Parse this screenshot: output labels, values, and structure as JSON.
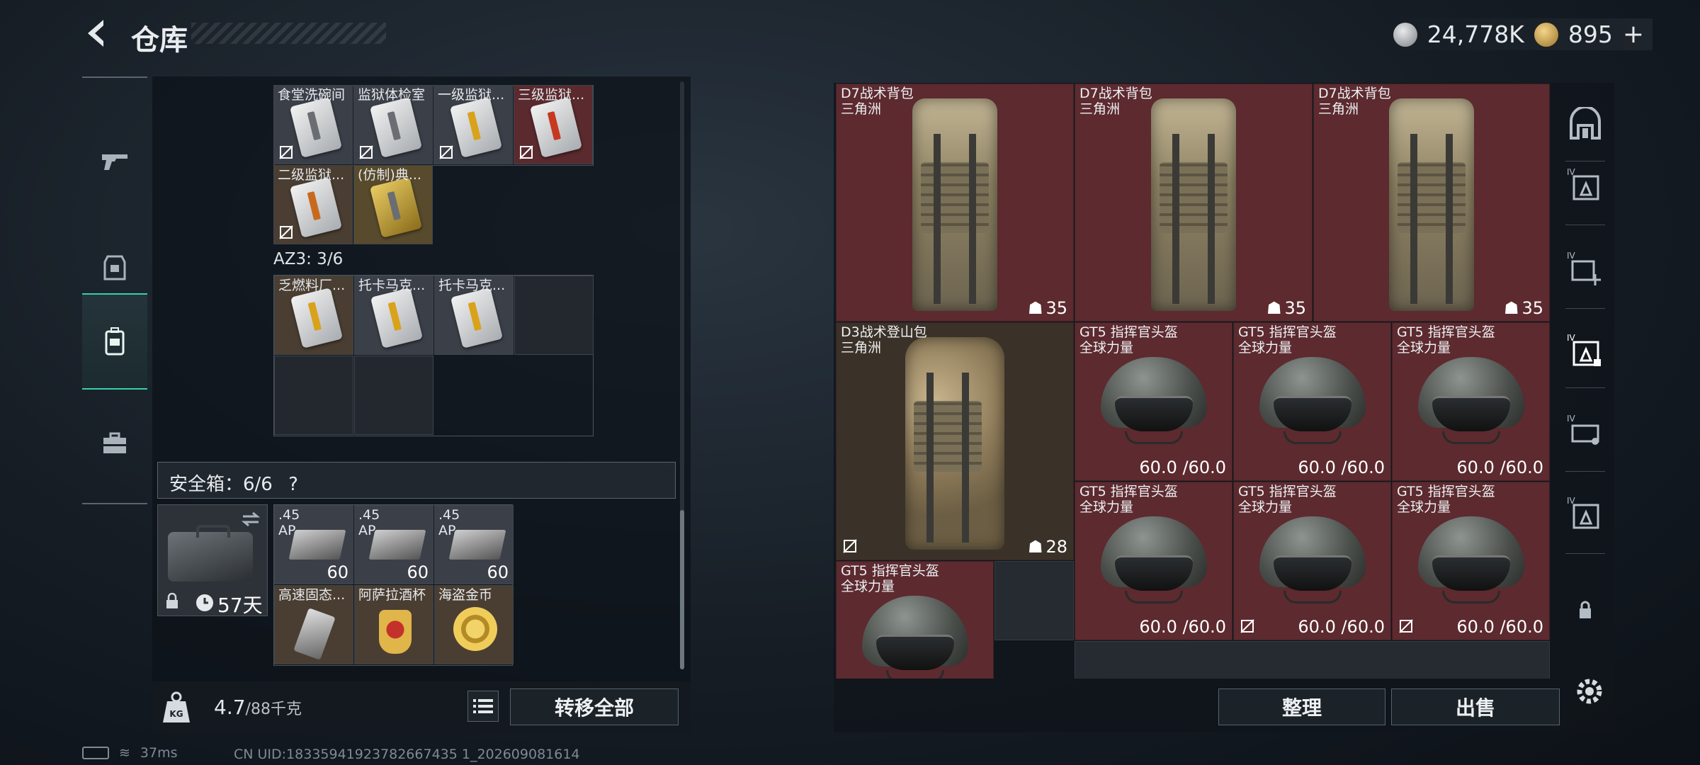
{
  "header": {
    "title": "仓库",
    "currency_primary": "24,778K",
    "currency_secondary": "895",
    "add_label": "+"
  },
  "upper_items": [
    {
      "label": "食堂洗碗间",
      "bg": "grey",
      "key": "grey",
      "not_tradable": true
    },
    {
      "label": "监狱体检室",
      "bg": "grey",
      "key": "grey",
      "not_tradable": false
    },
    {
      "label": "一级监狱...",
      "bg": "grey",
      "key": "yellow",
      "not_tradable": true
    },
    {
      "label": "三级监狱...",
      "bg": "red",
      "key": "red",
      "not_tradable": true
    },
    {
      "label": "二级监狱...",
      "bg": "brown",
      "key": "orange",
      "not_tradable": true
    },
    {
      "label": "(仿制)典...",
      "bg": "gold",
      "key": "gold",
      "not_tradable": false
    }
  ],
  "az3": {
    "label": "AZ3: 3/6",
    "items": [
      {
        "label": "乏燃料厂...",
        "bg": "brown"
      },
      {
        "label": "托卡马克...",
        "bg": "grey"
      },
      {
        "label": "托卡马克...",
        "bg": "grey"
      }
    ]
  },
  "safe_box": {
    "label": "安全箱：6/6",
    "help": "?",
    "days": "57天",
    "items": [
      {
        "label": ".45",
        "label2": "AP",
        "count": "60"
      },
      {
        "label": ".45",
        "label2": "AP",
        "count": "60"
      },
      {
        "label": ".45",
        "label2": "AP",
        "count": "60"
      },
      {
        "label": "高速固态..."
      },
      {
        "label": "阿萨拉酒杯"
      },
      {
        "label": "海盗金币"
      }
    ]
  },
  "weight": {
    "current": "4.7",
    "max": "/88千克"
  },
  "buttons": {
    "transfer_all": "转移全部",
    "sort": "整理",
    "sell": "出售"
  },
  "stash_items": [
    {
      "name": "D7战术背包",
      "origin": "三角洲",
      "value": "35",
      "type": "backpack"
    },
    {
      "name": "D7战术背包",
      "origin": "三角洲",
      "value": "35",
      "type": "backpack"
    },
    {
      "name": "D7战术背包",
      "origin": "三角洲",
      "value": "35",
      "type": "backpack"
    },
    {
      "name": "D3战术登山包",
      "origin": "三角洲",
      "value": "28",
      "type": "backpack"
    },
    {
      "name": "GT5 指挥官头盔",
      "origin": "全球力量",
      "value": "60.0 /60.0",
      "type": "helmet"
    },
    {
      "name": "GT5 指挥官头盔",
      "origin": "全球力量",
      "value": "60.0 /60.0",
      "type": "helmet"
    },
    {
      "name": "GT5 指挥官头盔",
      "origin": "全球力量",
      "value": "60.0 /60.0",
      "type": "helmet"
    },
    {
      "name": "GT5 指挥官头盔",
      "origin": "全球力量",
      "value": "60.0 /60.0",
      "type": "helmet"
    },
    {
      "name": "GT5 指挥官头盔",
      "origin": "全球力量",
      "value": "60.0 /60.0",
      "type": "helmet"
    },
    {
      "name": "GT5 指挥官头盔",
      "origin": "全球力量",
      "value": "60.0 /60.0",
      "type": "helmet"
    },
    {
      "name": "GT5 指挥官头盔",
      "origin": "全球力量",
      "value": "",
      "type": "helmet"
    }
  ],
  "status": {
    "ping": "37ms",
    "uid": "CN UID:18335941923782667435 1_202609081614"
  }
}
